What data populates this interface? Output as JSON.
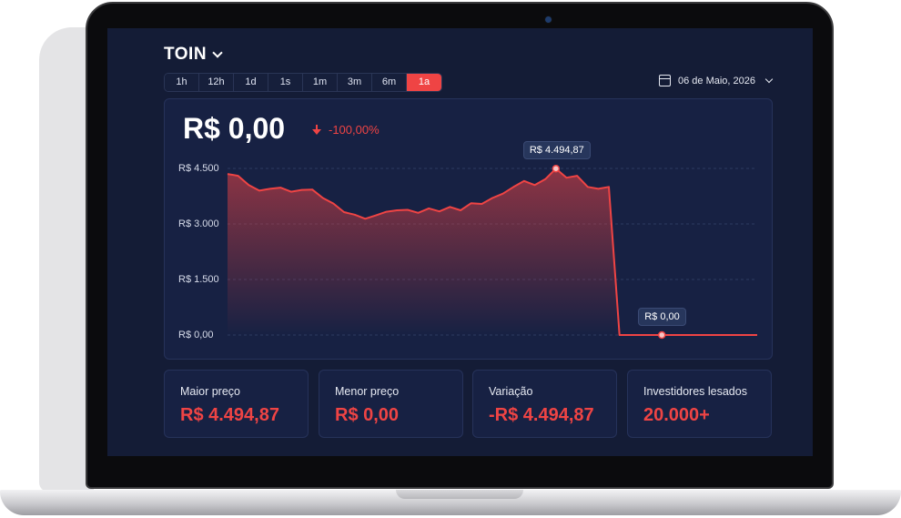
{
  "header": {
    "token_name": "TOIN"
  },
  "tabs": [
    {
      "label": "1h"
    },
    {
      "label": "12h"
    },
    {
      "label": "1d"
    },
    {
      "label": "1s"
    },
    {
      "label": "1m"
    },
    {
      "label": "3m"
    },
    {
      "label": "6m"
    },
    {
      "label": "1a",
      "active": true
    }
  ],
  "date": {
    "label": "06 de Maio, 2026"
  },
  "price": {
    "current": "R$ 0,00",
    "change": "-100,00%"
  },
  "colors": {
    "accent": "#ef4444",
    "background": "#141c36",
    "card": "#172143"
  },
  "chart_data": {
    "type": "area",
    "y_tick_labels": [
      "R$ 4.500",
      "R$ 3.000",
      "R$ 1.500",
      "R$ 0,00"
    ],
    "ylim": [
      0,
      4500
    ],
    "grid": true,
    "values": [
      4350,
      4300,
      4050,
      3900,
      3950,
      3980,
      3870,
      3920,
      3930,
      3700,
      3550,
      3320,
      3250,
      3140,
      3230,
      3330,
      3370,
      3380,
      3300,
      3420,
      3340,
      3460,
      3370,
      3560,
      3540,
      3700,
      3820,
      4000,
      4160,
      4050,
      4210,
      4494.87,
      4250,
      4300,
      4000,
      3950,
      4000,
      0,
      0,
      0,
      0,
      0,
      0,
      0,
      0,
      0,
      0,
      0,
      0,
      0,
      0
    ],
    "annotations": [
      {
        "label": "R$ 4.494,87",
        "value": 4494.87
      },
      {
        "label": "R$ 0,00",
        "value": 0
      }
    ]
  },
  "stats": [
    {
      "label": "Maior preço",
      "value": "R$ 4.494,87"
    },
    {
      "label": "Menor preço",
      "value": "R$ 0,00"
    },
    {
      "label": "Variação",
      "value": "-R$ 4.494,87"
    },
    {
      "label": "Investidores lesados",
      "value": "20.000+"
    }
  ]
}
